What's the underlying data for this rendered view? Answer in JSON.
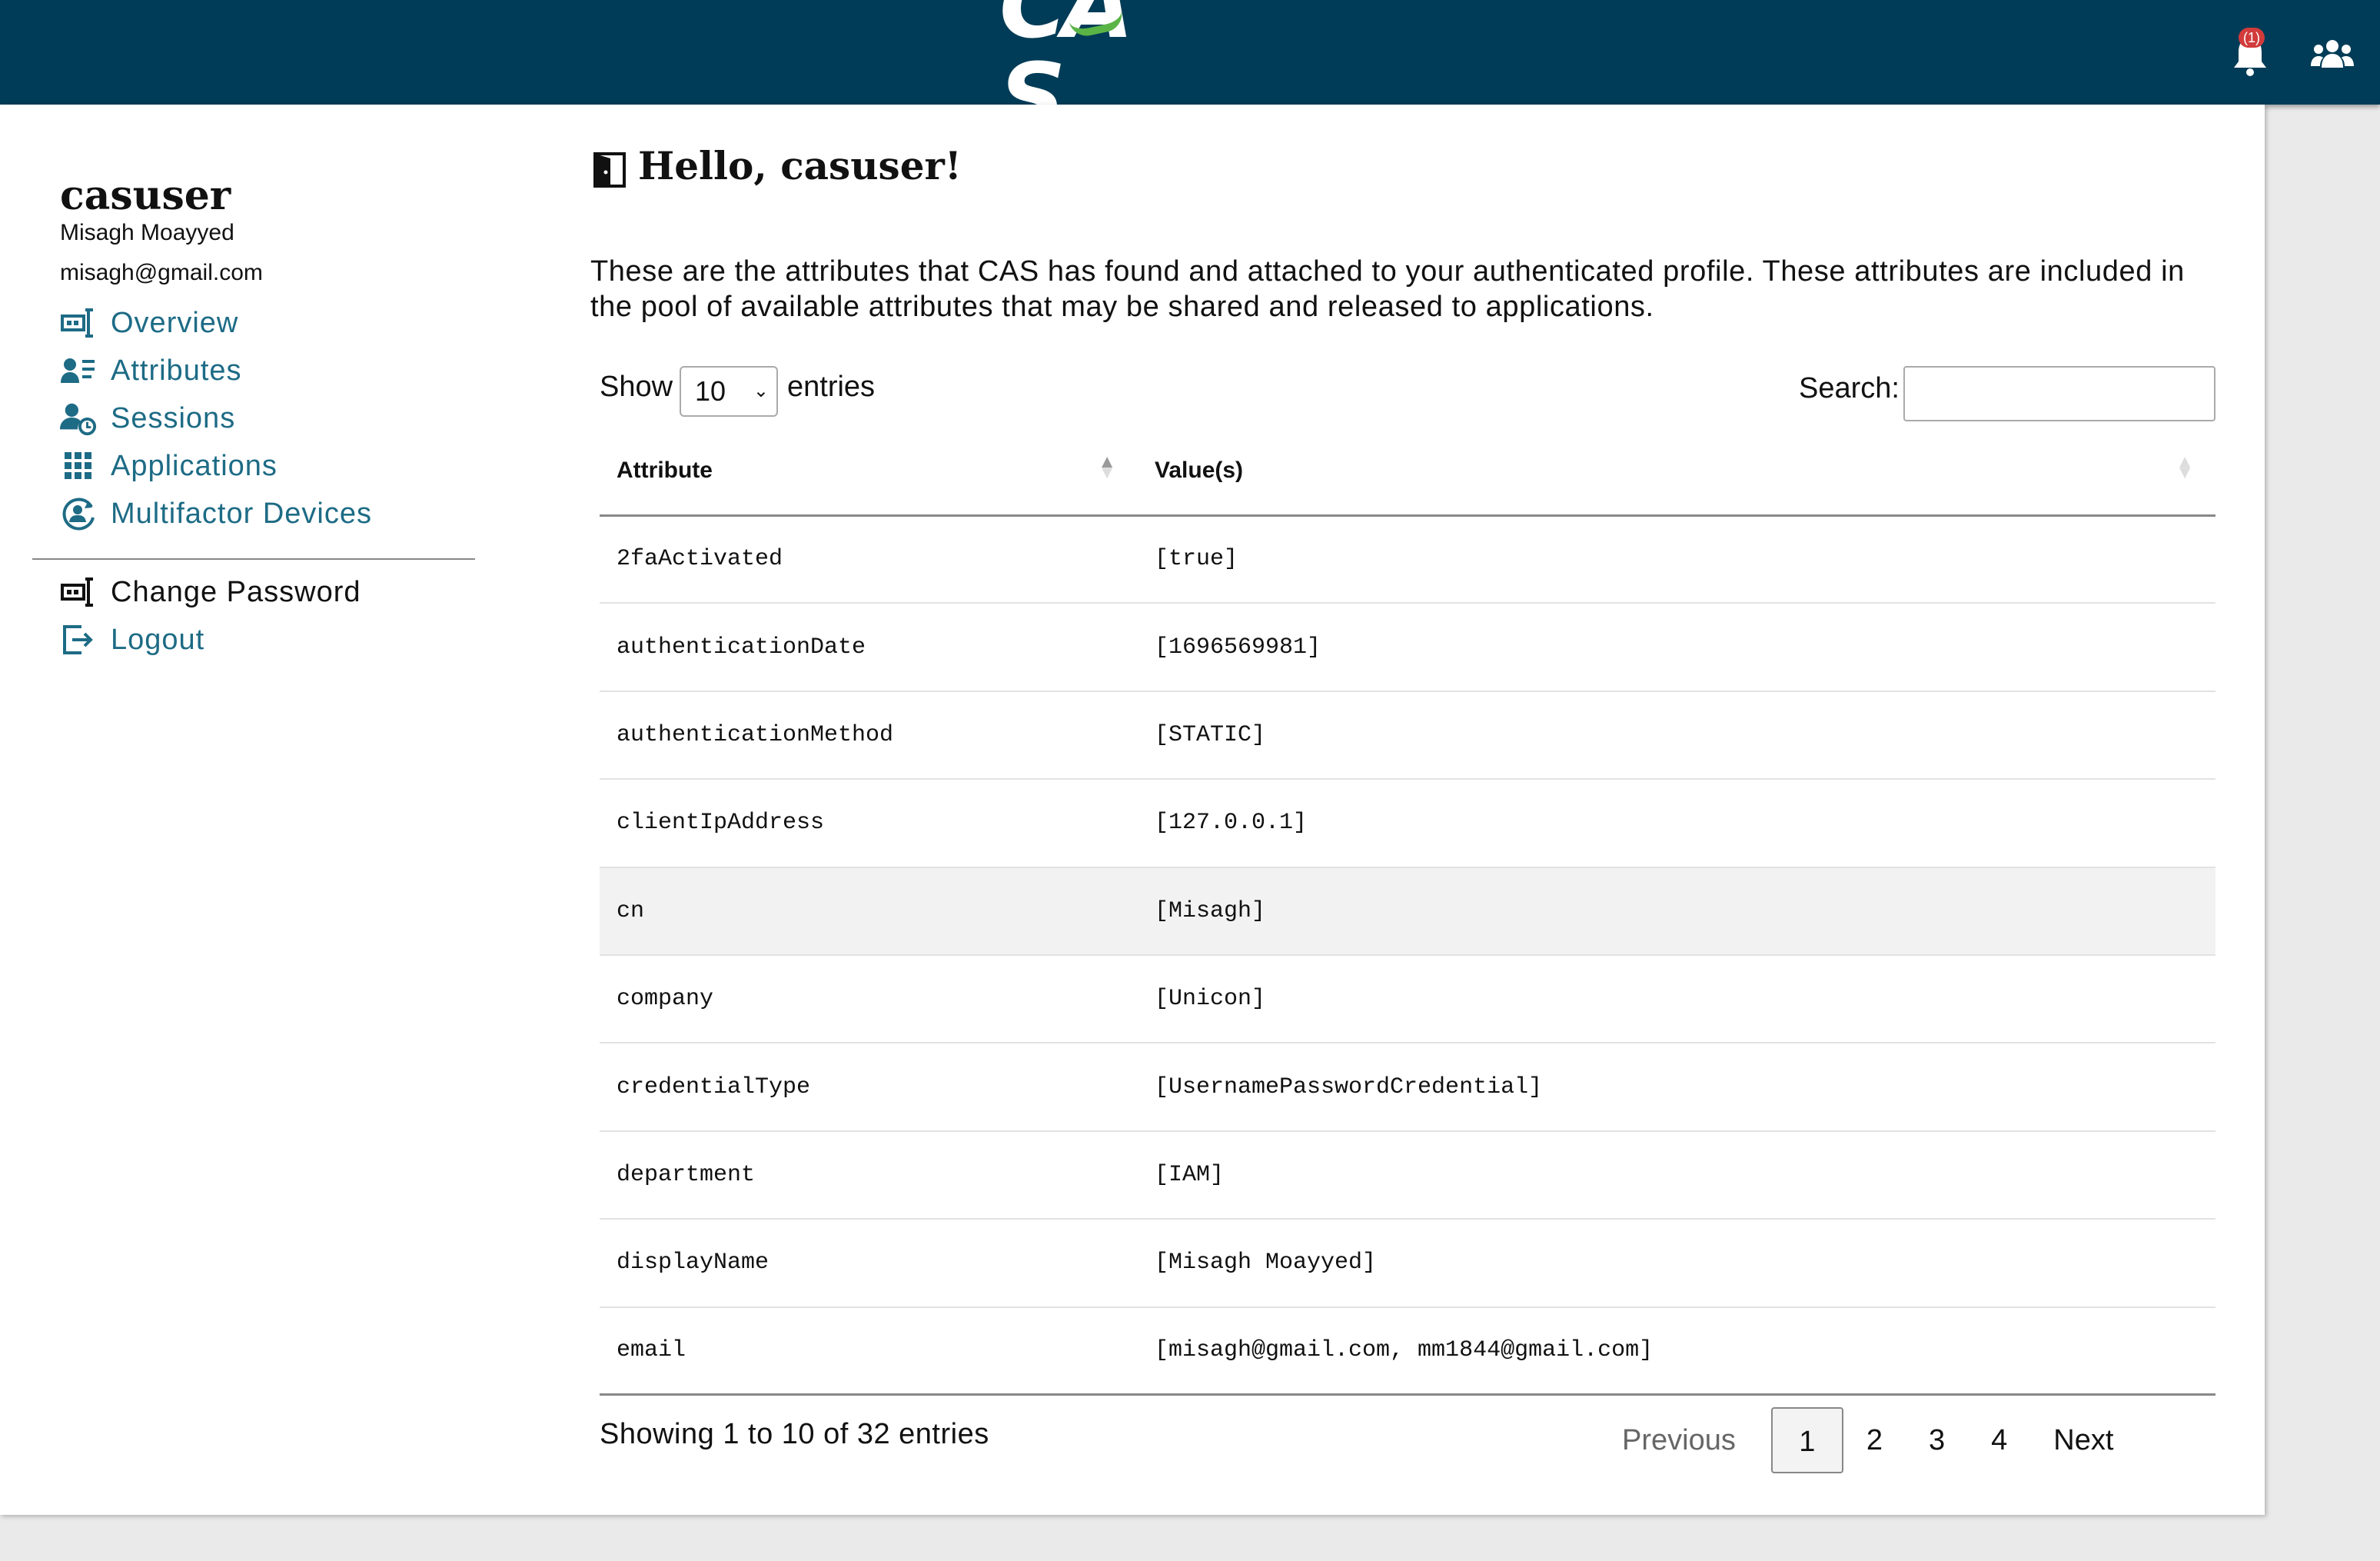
{
  "header": {
    "logo_text": "CAS",
    "notification_count": "(1)",
    "icons": [
      "bell-icon",
      "users-icon"
    ],
    "brand_color": "#003c57"
  },
  "sidebar": {
    "username": "casuser",
    "full_name": "Misagh Moayyed",
    "email": "misagh@gmail.com",
    "nav": [
      {
        "label": "Overview",
        "icon": "overview-icon"
      },
      {
        "label": "Attributes",
        "icon": "attributes-icon"
      },
      {
        "label": "Sessions",
        "icon": "sessions-icon"
      },
      {
        "label": "Applications",
        "icon": "applications-icon"
      },
      {
        "label": "Multifactor Devices",
        "icon": "mfa-devices-icon"
      }
    ],
    "secondary": [
      {
        "label": "Change Password",
        "icon": "password-icon"
      },
      {
        "label": "Logout",
        "icon": "logout-icon"
      }
    ]
  },
  "main": {
    "greeting": "Hello, casuser!",
    "description": "These are the attributes that CAS has found and attached to your authenticated profile. These attributes are included in the pool of available attributes that may be shared and released to applications.",
    "show_label": "Show",
    "page_size": "10",
    "entries_label": "entries",
    "search_label": "Search:",
    "search_value": "",
    "columns": [
      "Attribute",
      "Value(s)"
    ],
    "rows": [
      {
        "attribute": "2faActivated",
        "value": "[true]"
      },
      {
        "attribute": "authenticationDate",
        "value": "[1696569981]"
      },
      {
        "attribute": "authenticationMethod",
        "value": "[STATIC]"
      },
      {
        "attribute": "clientIpAddress",
        "value": "[127.0.0.1]"
      },
      {
        "attribute": "cn",
        "value": "[Misagh]"
      },
      {
        "attribute": "company",
        "value": "[Unicon]"
      },
      {
        "attribute": "credentialType",
        "value": "[UsernamePasswordCredential]"
      },
      {
        "attribute": "department",
        "value": "[IAM]"
      },
      {
        "attribute": "displayName",
        "value": "[Misagh Moayyed]"
      },
      {
        "attribute": "email",
        "value": "[misagh@gmail.com, mm1844@gmail.com]"
      }
    ],
    "showing_text": "Showing 1 to 10 of 32 entries",
    "pagination": {
      "previous": "Previous",
      "pages": [
        "1",
        "2",
        "3",
        "4"
      ],
      "current": "1",
      "next": "Next"
    }
  }
}
